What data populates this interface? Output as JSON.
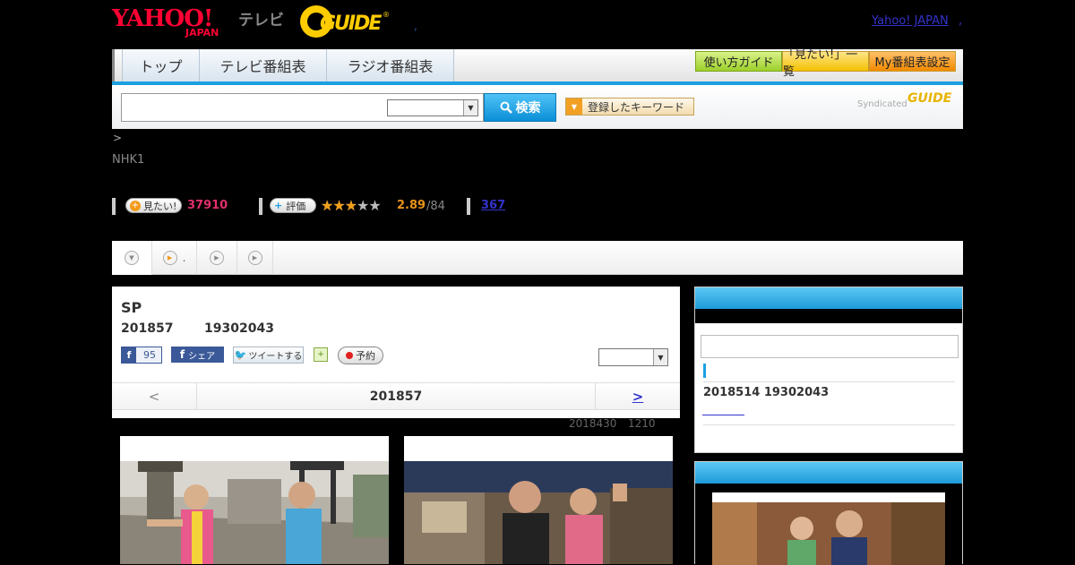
{
  "header": {
    "yahoo_logo": "YAHOO!",
    "yahoo_logo_sub": "JAPAN",
    "tv_label": "テレビ",
    "gguide_logo": "GUIDE",
    "link_dot": ",",
    "yahoo_japan_link": "Yahoo! JAPAN",
    "yahoo_japan_dot": ","
  },
  "nav": {
    "tabs": [
      {
        "label": "トップ"
      },
      {
        "label": "テレビ番組表"
      },
      {
        "label": "ラジオ番組表"
      }
    ],
    "guide_button": "使い方ガイド",
    "mitai_list_button": "「見たい!」一覧",
    "my_schedule_button": "My番組表設定",
    "accent_color": "#1da0e2"
  },
  "search": {
    "input_value": "",
    "select_value": "",
    "button_label": "検索",
    "keywords_button": "登録したキーワード",
    "syndicated": "Syndicated",
    "syndicated_logo": "GUIDE"
  },
  "breadcrumb": ">",
  "channel": "NHK1",
  "stats": {
    "mitai_label": "見たい!",
    "mitai_count": "37910",
    "rate_label": "評価",
    "stars": "★★★★★",
    "rating_value": 2.89,
    "rating": "2.89",
    "rating_total": "/84",
    "review_count": "367"
  },
  "subtabs": [
    {
      "icon": "chevron-down-icon",
      "label": ""
    },
    {
      "icon": "play-icon",
      "label": "."
    },
    {
      "icon": "play-icon",
      "label": ""
    },
    {
      "icon": "play-icon",
      "label": ""
    }
  ],
  "program": {
    "title": "SP",
    "air_date": "201857",
    "air_time": "19302043",
    "fb_like_count": "95",
    "fb_share": "シェア",
    "tweet": "ツイートする",
    "reserve": "予約",
    "select_value": "",
    "pager_prev": "<",
    "pager_date": "201857",
    "pager_next": ">",
    "updated_date": "2018430",
    "updated_time": "1210"
  },
  "sidebar": {
    "date": "2018514  19302043",
    "input_value": ""
  }
}
